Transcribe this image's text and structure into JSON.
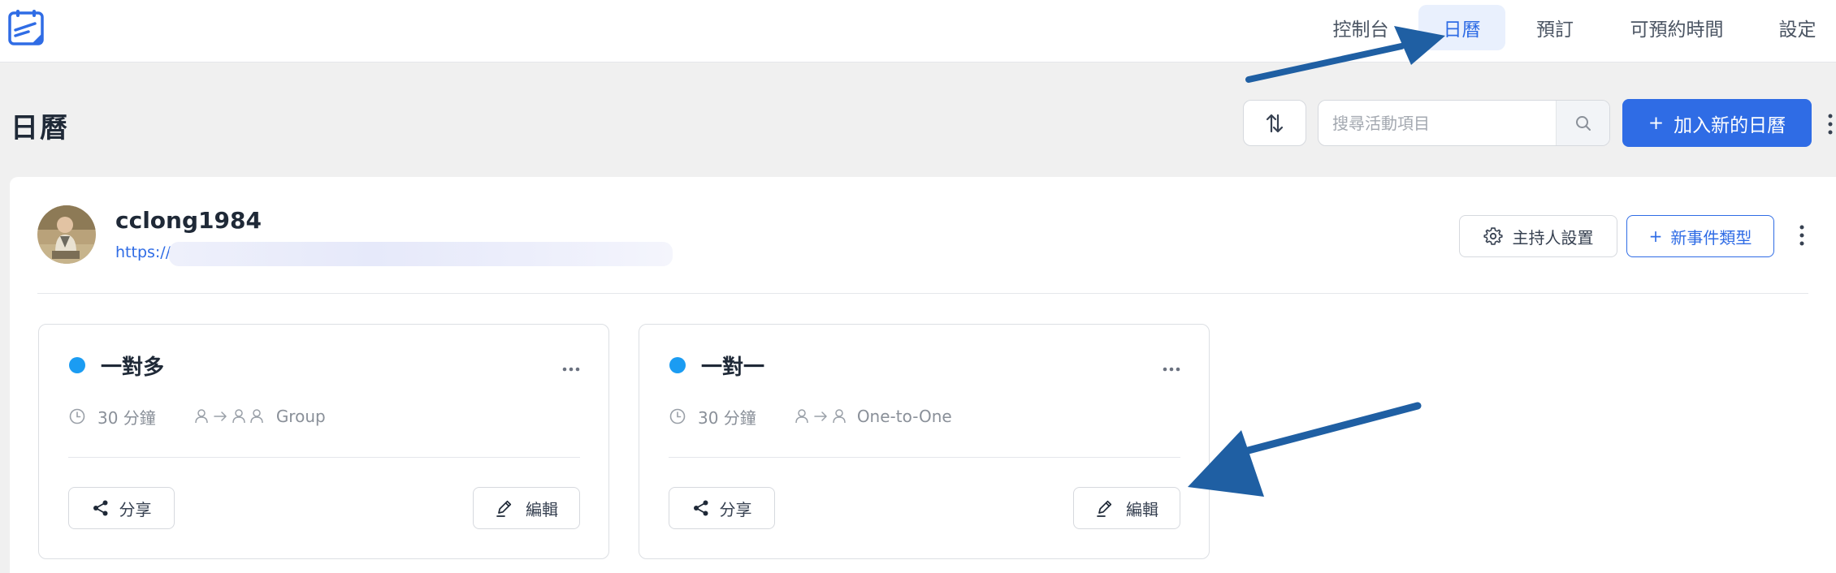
{
  "nav": {
    "items": [
      {
        "label": "控制台",
        "active": false
      },
      {
        "label": "日曆",
        "active": true
      },
      {
        "label": "預訂",
        "active": false
      },
      {
        "label": "可預約時間",
        "active": false
      },
      {
        "label": "設定",
        "active": false
      }
    ]
  },
  "header": {
    "title": "日曆",
    "search_placeholder": "搜尋活動項目",
    "add_button_label": "加入新的日曆",
    "add_button_plus": "+"
  },
  "profile": {
    "username": "cclong1984",
    "link_prefix": "https://",
    "host_settings_label": "主持人設置",
    "new_event_type_label": "新事件類型",
    "new_event_type_plus": "+"
  },
  "events": [
    {
      "title": "一對多",
      "duration": "30 分鐘",
      "type_label": "Group",
      "share_label": "分享",
      "edit_label": "編輯"
    },
    {
      "title": "一對一",
      "duration": "30 分鐘",
      "type_label": "One-to-One",
      "share_label": "分享",
      "edit_label": "編輯"
    }
  ],
  "colors": {
    "accent": "#2f6ce5",
    "event_dot": "#1b9cf2",
    "annotation_arrow": "#1f5fa3"
  },
  "icons": {
    "logo": "calendar-pen-logo",
    "sort": "sort-arrows-icon",
    "search": "search-icon",
    "kebab": "kebab-icon",
    "gear": "gear-icon",
    "clock": "clock-icon",
    "share": "share-icon",
    "edit": "edit-pencil-icon"
  }
}
